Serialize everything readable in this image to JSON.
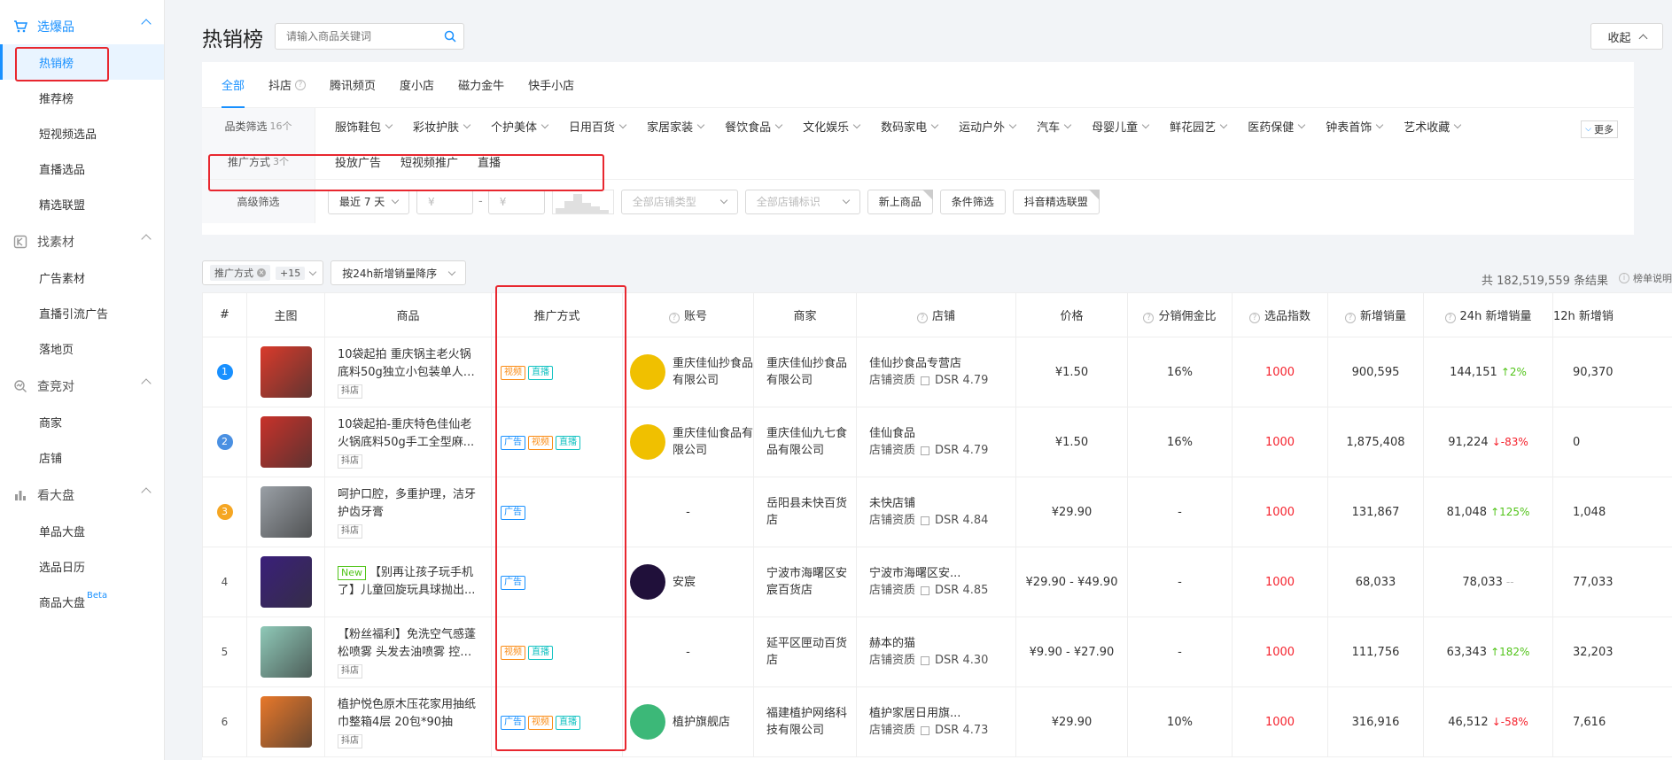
{
  "sidebar": {
    "groups": [
      {
        "label": "选爆品",
        "icon": "cart-icon",
        "active": true,
        "items": [
          "热销榜",
          "推荐榜",
          "短视频选品",
          "直播选品",
          "精选联盟"
        ]
      },
      {
        "label": "找素材",
        "icon": "material-icon",
        "active": false,
        "items": [
          "广告素材",
          "直播引流广告",
          "落地页"
        ]
      },
      {
        "label": "查竞对",
        "icon": "competitor-icon",
        "active": false,
        "items": [
          "商家",
          "店铺"
        ]
      },
      {
        "label": "看大盘",
        "icon": "bar-chart-icon",
        "active": false,
        "items": [
          "单品大盘",
          "选品日历",
          "商品大盘"
        ]
      }
    ],
    "beta_label": "Beta"
  },
  "header": {
    "title": "热销榜",
    "search_placeholder": "请输入商品关键词",
    "collapse_label": "收起"
  },
  "tabs": [
    "全部",
    "抖店",
    "腾讯频页",
    "度小店",
    "磁力金牛",
    "快手小店"
  ],
  "category_filter": {
    "label": "品类筛选",
    "count": "16个",
    "items": [
      "服饰鞋包",
      "彩妆护肤",
      "个护美体",
      "日用百货",
      "家居家装",
      "餐饮食品",
      "文化娱乐",
      "数码家电",
      "运动户外",
      "汽车",
      "母婴儿童",
      "鲜花园艺",
      "医药保健",
      "钟表首饰",
      "艺术收藏"
    ],
    "more_label": "更多"
  },
  "promo_filter": {
    "label": "推广方式",
    "count": "3个",
    "items": [
      "投放广告",
      "短视频推广",
      "直播"
    ]
  },
  "advanced_filter": {
    "label": "高级筛选",
    "date_range": "最近 7 天",
    "price_min_placeholder": "¥",
    "price_sep": "-",
    "price_max_placeholder": "¥",
    "store_type_placeholder": "全部店铺类型",
    "store_tag_placeholder": "全部店铺标识",
    "buttons": [
      "新上商品",
      "条件筛选",
      "抖音精选联盟"
    ]
  },
  "toolbar": {
    "chip_label": "推广方式",
    "chip_extra": "+15",
    "sort_label": "按24h新增销量降序",
    "result_count": "共 182,519,559 条结果",
    "rank_note": "榜单说明"
  },
  "columns": [
    "#",
    "主图",
    "商品",
    "推广方式",
    "账号",
    "商家",
    "店铺",
    "价格",
    "分销佣金比",
    "选品指数",
    "新增销量",
    "24h 新增销量",
    "12h 新增销"
  ],
  "promo_tag_labels": {
    "ad": "广告",
    "video": "视频",
    "live": "直播"
  },
  "store_qualification_label": "店铺资质",
  "rows": [
    {
      "rank": "1",
      "rank_color": "#1890ff",
      "thumb_color": "#d93a2b",
      "is_new": false,
      "title": "10袋起拍 重庆锅主老火锅底料50g独立小包装单人份...",
      "source": "抖店",
      "promos": [
        "video",
        "live"
      ],
      "account": "重庆佳仙抄食品有限公司",
      "avatar_color": "#f0c000",
      "merchant": "重庆佳仙抄食品有限公司",
      "store": "佳仙抄食品专营店",
      "dsr": "DSR 4.79",
      "price": "¥1.50",
      "commission": "16%",
      "index": "1000",
      "sales": "900,595",
      "sales24": "144,151",
      "trend_dir": "up",
      "trend": "2%",
      "sales12": "90,370"
    },
    {
      "rank": "2",
      "rank_color": "#4a90e2",
      "thumb_color": "#c8322a",
      "is_new": false,
      "title": "10袋起拍-重庆特色佳仙老火锅底料50g手工全型麻...",
      "source": "抖店",
      "promos": [
        "ad",
        "video",
        "live"
      ],
      "account": "重庆佳仙食品有限公司",
      "avatar_color": "#f0c000",
      "merchant": "重庆佳仙九七食品有限公司",
      "store": "佳仙食品",
      "dsr": "DSR 4.79",
      "price": "¥1.50",
      "commission": "16%",
      "index": "1000",
      "sales": "1,875,408",
      "sales24": "91,224",
      "trend_dir": "down",
      "trend": "-83%",
      "sales12": "0"
    },
    {
      "rank": "3",
      "rank_color": "#f5a623",
      "thumb_color": "#9aa0a6",
      "is_new": false,
      "title": "呵护口腔，多重护理，洁牙护齿牙膏",
      "source": "抖店",
      "promos": [
        "ad"
      ],
      "account": "-",
      "avatar_color": "",
      "merchant": "岳阳县未快百货店",
      "store": "未快店铺",
      "dsr": "DSR 4.84",
      "price": "¥29.90",
      "commission": "-",
      "index": "1000",
      "sales": "131,867",
      "sales24": "81,048",
      "trend_dir": "up",
      "trend": "125%",
      "sales12": "1,048"
    },
    {
      "rank": "4",
      "rank_color": "",
      "thumb_color": "#3a1f7a",
      "is_new": true,
      "new_label": "New",
      "title": "【别再让孩子玩手机了】儿童回旋玩具球抛出...",
      "source": "",
      "promos": [
        "ad"
      ],
      "account": "安宸",
      "avatar_color": "#20103a",
      "merchant": "宁波市海曙区安宸百货店",
      "store": "宁波市海曙区安...",
      "dsr": "DSR 4.85",
      "price": "¥29.90 - ¥49.90",
      "commission": "-",
      "index": "1000",
      "sales": "68,033",
      "sales24": "78,033",
      "trend_dir": "flat",
      "trend": "--",
      "sales12": "77,033"
    },
    {
      "rank": "5",
      "rank_color": "",
      "thumb_color": "#8fc9b8",
      "is_new": false,
      "title": "【粉丝福利】免洗空气感蓬松喷雾 头发去油喷雾 控油...",
      "source": "抖店",
      "promos": [
        "video",
        "live"
      ],
      "account": "-",
      "avatar_color": "",
      "merchant": "延平区匣动百货店",
      "store": "赫本的猫",
      "dsr": "DSR 4.30",
      "price": "¥9.90 - ¥27.90",
      "commission": "-",
      "index": "1000",
      "sales": "111,756",
      "sales24": "63,343",
      "trend_dir": "up",
      "trend": "182%",
      "sales12": "32,203"
    },
    {
      "rank": "6",
      "rank_color": "",
      "thumb_color": "#e8782a",
      "is_new": false,
      "title": "植护悦色原木压花家用抽纸巾整箱4层 20包*90抽",
      "source": "抖店",
      "promos": [
        "ad",
        "video",
        "live"
      ],
      "account": "植护旗舰店",
      "avatar_color": "#3cb878",
      "merchant": "福建植护网络科技有限公司",
      "store": "植护家居日用旗...",
      "dsr": "DSR 4.73",
      "price": "¥29.90",
      "commission": "10%",
      "index": "1000",
      "sales": "316,916",
      "sales24": "46,512",
      "trend_dir": "down",
      "trend": "-58%",
      "sales12": "7,616"
    }
  ]
}
